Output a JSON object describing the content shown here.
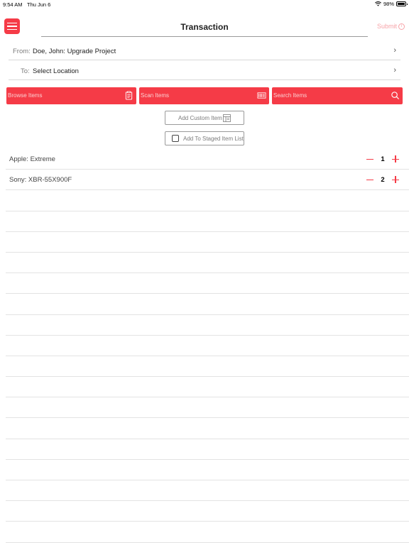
{
  "status_bar": {
    "time": "9:54 AM",
    "date": "Thu Jun 6",
    "battery": "98%",
    "battery_level": 0.98
  },
  "header": {
    "title": "Transaction",
    "submit_label": "Submit",
    "submit_icon": "info-circle-icon",
    "menu_icon": "hamburger-menu-icon"
  },
  "colors": {
    "accent": "#f53b47",
    "accent_text_light": "#fbd0d3",
    "submit_disabled": "#f7a3a8",
    "divider": "#e3e3e3"
  },
  "from": {
    "label": "From:",
    "value": "Doe, John: Upgrade Project"
  },
  "to": {
    "label": "To:",
    "value": "Select Location"
  },
  "actions": {
    "browse": {
      "label": "Browse Items",
      "icon": "clipboard-icon"
    },
    "scan": {
      "label": "Scan Items",
      "icon": "barcode-icon"
    },
    "search": {
      "label": "Search Items",
      "icon": "search-icon"
    }
  },
  "custom_item": {
    "label": "Add Custom Item",
    "icon": "form-icon"
  },
  "staged": {
    "label": "Add To Staged Item List",
    "checked": false
  },
  "items": [
    {
      "name": "Apple: Extreme",
      "qty": "1"
    },
    {
      "name": "Sony: XBR-55X900F",
      "qty": "2"
    }
  ]
}
